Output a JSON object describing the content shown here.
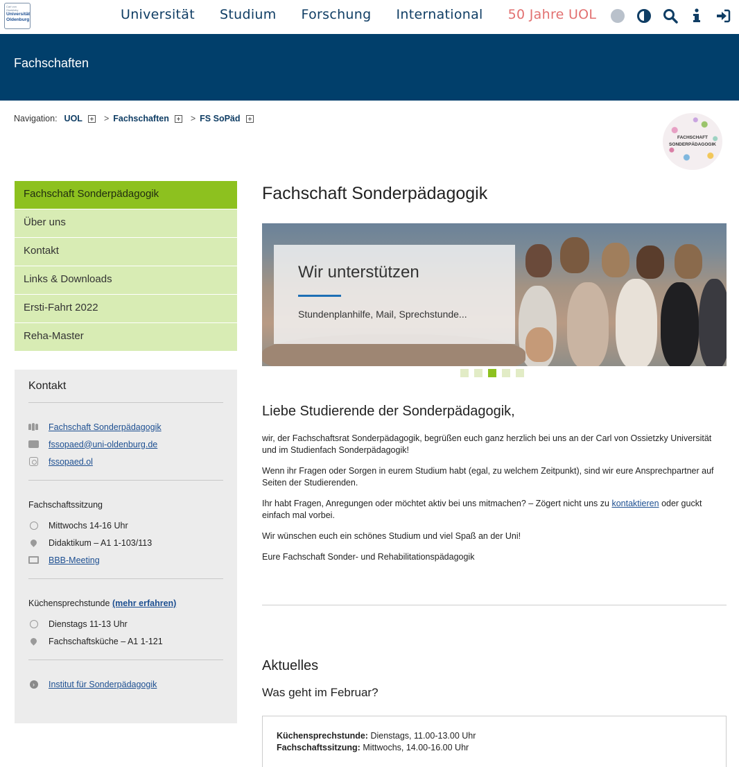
{
  "logo": {
    "line1": "Carl von Ossietzky",
    "line2": "Universität",
    "line3": "Oldenburg"
  },
  "topnav": {
    "items": [
      "Universität",
      "Studium",
      "Forschung",
      "International"
    ],
    "anniversary": "50 Jahre UOL",
    "icons": [
      "globe-icon",
      "contrast-icon",
      "search-icon",
      "info-icon",
      "login-icon"
    ]
  },
  "banner": {
    "title": "Fachschaften"
  },
  "breadcrumb": {
    "label": "Navigation:",
    "items": [
      "UOL",
      "Fachschaften",
      "FS SoPäd"
    ],
    "separator": ">"
  },
  "badge": {
    "line1": "FACHSCHAFT",
    "line2": "SONDERPÄDAGOGIK"
  },
  "sidebar": {
    "items": [
      "Fachschaft Sonderpädagogik",
      "Über uns",
      "Kontakt",
      "Links & Downloads",
      "Ersti-Fahrt 2022",
      "Reha-Master"
    ]
  },
  "kontakt": {
    "title": "Kontakt",
    "links": [
      "Fachschaft Sonderpädagogik",
      "fssopaed@uni-oldenburg.de",
      "fssopaed.ol"
    ],
    "sitzung": {
      "title": "Fachschaftssitzung",
      "time": "Mittwochs 14-16 Uhr",
      "place": "Didaktikum – A1 1-103/113",
      "link": "BBB-Meeting"
    },
    "kueche": {
      "title": "Küchensprechstunde",
      "more": "(mehr erfahren)",
      "time": "Dienstags 11-13 Uhr",
      "place": "Fachschaftsküche – A1 1-121"
    },
    "institut": "Institut für Sonderpädagogik"
  },
  "main": {
    "title": "Fachschaft Sonderpädagogik",
    "slide": {
      "title": "Wir unterstützen",
      "subtitle": "Stundenplanhilfe, Mail, Sprechstunde..."
    },
    "greeting": "Liebe Studierende der Sonderpädagogik,",
    "p1": "wir, der Fachschaftsrat Sonderpädagogik, begrüßen euch ganz herzlich bei uns an der Carl von Ossietzky Universität und im Studienfach Sonderpädagogik!",
    "p2": "Wenn ihr Fragen oder Sorgen in eurem Studium habt (egal, zu welchem Zeitpunkt), sind wir eure Ansprechpartner auf Seiten der Studierenden.",
    "p3a": "Ihr habt Fragen, Anregungen oder möchtet aktiv bei uns mitmachen? – Zögert nicht uns zu",
    "p3link": "kontaktieren",
    "p3b": "oder guckt einfach mal vorbei.",
    "p4": "Wir wünschen euch ein schönes Studium und viel Spaß an der Uni!",
    "p5": "Eure Fachschaft Sonder- und Rehabilitationspädagogik",
    "news_title": "Aktuelles",
    "news_sub": "Was geht im Februar?",
    "news": [
      {
        "label": "Küchensprechstunde:",
        "text": "Dienstags, 11.00-13.00 Uhr"
      },
      {
        "label": "Fachschaftssitzung:",
        "text": "Mittwochs, 14.00-16.00 Uhr"
      }
    ]
  },
  "colors": {
    "navy": "#013f6b",
    "green": "#8dc11f",
    "light_green": "#d8ecb4",
    "anniversary": "#e27070"
  }
}
